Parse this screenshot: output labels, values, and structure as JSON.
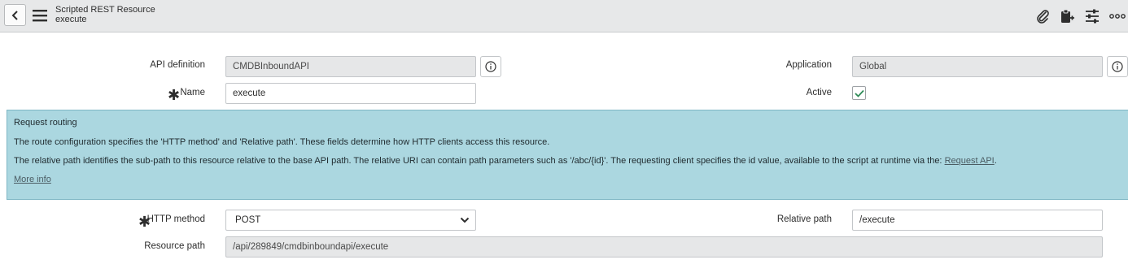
{
  "header": {
    "title": "Scripted REST Resource",
    "subtitle": "execute",
    "icons": [
      "back-icon",
      "hamburger-menu-icon",
      "paperclip-icon",
      "clipboard-icon",
      "sliders-icon",
      "more-icon"
    ]
  },
  "form": {
    "api_definition": {
      "label": "API definition",
      "value": "CMDBInboundAPI"
    },
    "name": {
      "label": "Name",
      "value": "execute",
      "required": true
    },
    "application": {
      "label": "Application",
      "value": "Global"
    },
    "active": {
      "label": "Active",
      "checked": true
    },
    "http_method": {
      "label": "HTTP method",
      "value": "POST",
      "required": true
    },
    "relative_path": {
      "label": "Relative path",
      "value": "/execute"
    },
    "resource_path": {
      "label": "Resource path",
      "value": "/api/289849/cmdbinboundapi/execute"
    }
  },
  "routing": {
    "title": "Request routing",
    "line1": "The route configuration specifies the 'HTTP method' and 'Relative path'. These fields determine how HTTP clients access this resource.",
    "line2_prefix": "The relative path identifies the sub-path to this resource relative to the base API path. The relative URI can contain path parameters such as '/abc/{id}'. The requesting client specifies the id value, available to the script at runtime via the: ",
    "line2_link": "Request API",
    "line2_suffix": ".",
    "more_info": "More info"
  },
  "colors": {
    "header_bg": "#e7e8e9",
    "routing_bg": "#abd7e0",
    "check_color": "#2e8b57"
  }
}
